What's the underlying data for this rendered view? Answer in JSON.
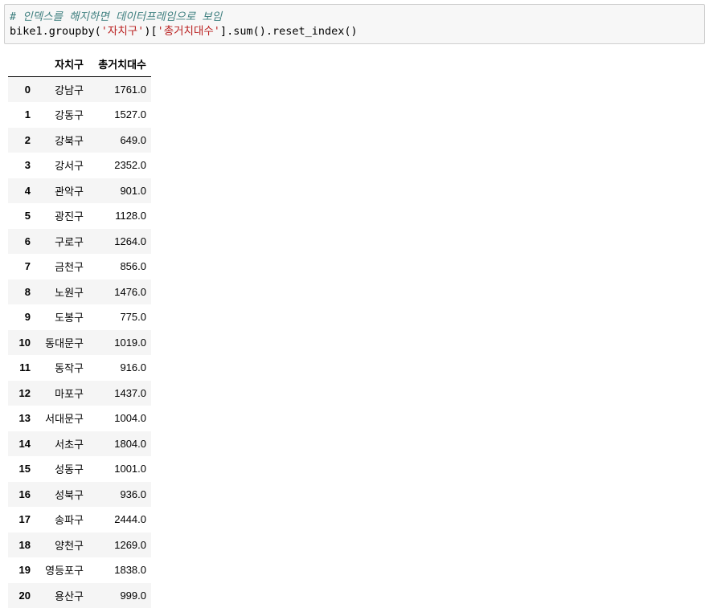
{
  "code_cell": {
    "comment": "# 인덱스를 해지하면 데이터프레임으로 보임",
    "code_prefix": "bike1.groupby(",
    "str1": "'자치구'",
    "code_mid": ")[",
    "str2": "'총거치대수'",
    "code_suffix": "].sum().reset_index()"
  },
  "table": {
    "columns": [
      "",
      "자치구",
      "총거치대수"
    ],
    "rows": [
      {
        "index": "0",
        "gu": "강남구",
        "total": "1761.0"
      },
      {
        "index": "1",
        "gu": "강동구",
        "total": "1527.0"
      },
      {
        "index": "2",
        "gu": "강북구",
        "total": "649.0"
      },
      {
        "index": "3",
        "gu": "강서구",
        "total": "2352.0"
      },
      {
        "index": "4",
        "gu": "관악구",
        "total": "901.0"
      },
      {
        "index": "5",
        "gu": "광진구",
        "total": "1128.0"
      },
      {
        "index": "6",
        "gu": "구로구",
        "total": "1264.0"
      },
      {
        "index": "7",
        "gu": "금천구",
        "total": "856.0"
      },
      {
        "index": "8",
        "gu": "노원구",
        "total": "1476.0"
      },
      {
        "index": "9",
        "gu": "도봉구",
        "total": "775.0"
      },
      {
        "index": "10",
        "gu": "동대문구",
        "total": "1019.0"
      },
      {
        "index": "11",
        "gu": "동작구",
        "total": "916.0"
      },
      {
        "index": "12",
        "gu": "마포구",
        "total": "1437.0"
      },
      {
        "index": "13",
        "gu": "서대문구",
        "total": "1004.0"
      },
      {
        "index": "14",
        "gu": "서초구",
        "total": "1804.0"
      },
      {
        "index": "15",
        "gu": "성동구",
        "total": "1001.0"
      },
      {
        "index": "16",
        "gu": "성북구",
        "total": "936.0"
      },
      {
        "index": "17",
        "gu": "송파구",
        "total": "2444.0"
      },
      {
        "index": "18",
        "gu": "양천구",
        "total": "1269.0"
      },
      {
        "index": "19",
        "gu": "영등포구",
        "total": "1838.0"
      },
      {
        "index": "20",
        "gu": "용산구",
        "total": "999.0"
      }
    ]
  },
  "colors": {
    "comment": "#408080",
    "string": "#ba2121",
    "cell_background": "#f7f7f7",
    "row_stripe": "#f5f5f5"
  }
}
